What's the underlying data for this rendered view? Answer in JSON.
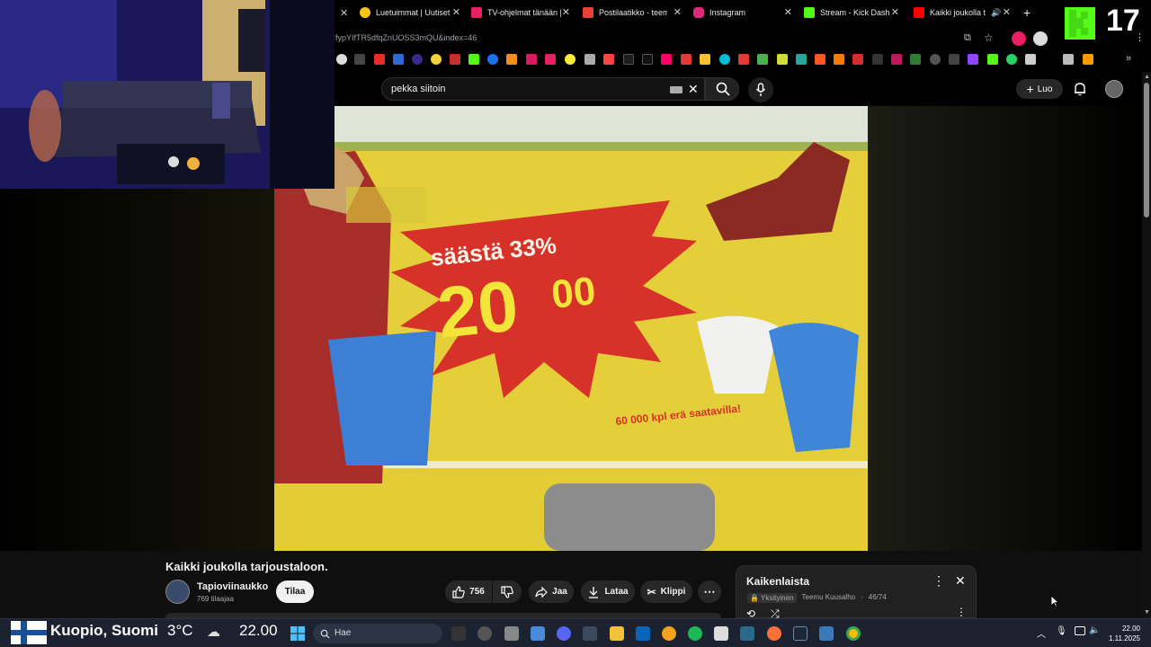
{
  "browser": {
    "tabs": [
      {
        "label": "Luetuimmat | Uutiset",
        "color": "#f5c518"
      },
      {
        "label": "TV-ohjelmat tänään |",
        "color": "#e91e63"
      },
      {
        "label": "Postilaatikko - teemu",
        "color": "#ea4335"
      },
      {
        "label": "Instagram",
        "color": "#dd2a7b"
      },
      {
        "label": "Stream - Kick Dashbo",
        "color": "#53fc18"
      },
      {
        "label": "Kaikki joukolla ta",
        "color": "#ff0000"
      }
    ],
    "new_tab": "+",
    "url": "fypYIfTR5dfqZnUOSS3mQU&index=46"
  },
  "youtube": {
    "search_value": "pekka siitoin",
    "create_label": "Luo",
    "video": {
      "title": "Kaikki joukolla tarjoustaloon.",
      "channel": "Tapioviinaukko",
      "subscribers": "769 tilaajaa",
      "subscribe_label": "Tilaa",
      "likes": "756",
      "share_label": "Jaa",
      "download_label": "Lataa",
      "clip_label": "Klippi",
      "frame_text": {
        "savings": "säästä 33%",
        "price": "20",
        "price_cents": "00",
        "fine_print": "60 000 kpl erä saatavilla!"
      }
    },
    "playlist": {
      "title": "Kaikenlaista",
      "privacy": "Yksityinen",
      "owner": "Teemu Kuusalho",
      "position": "46/74"
    }
  },
  "stream_overlay": {
    "count": "17"
  },
  "taskbar": {
    "weather_location": "Kuopio, Suomi",
    "temperature": "3°C",
    "time_large": "22.00",
    "search_placeholder": "Hae",
    "clock_time": "22.00",
    "clock_date": "1.11.2025"
  },
  "colors": {
    "youtube_red": "#ff0000",
    "kick_green": "#53fc18",
    "video_yellow": "#e6d23a",
    "video_red": "#d6322a"
  }
}
